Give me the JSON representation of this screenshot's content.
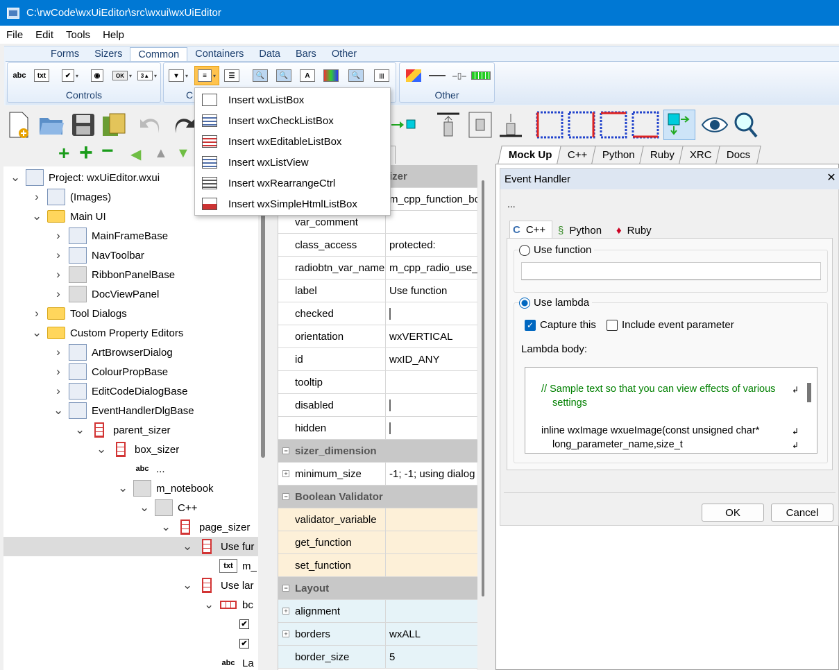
{
  "window": {
    "title": "C:\\rwCode\\wxUiEditor\\src\\wxui\\wxUiEditor"
  },
  "menu": [
    "File",
    "Edit",
    "Tools",
    "Help"
  ],
  "ribbon": {
    "tabs": [
      "Forms",
      "Sizers",
      "Common",
      "Containers",
      "Data",
      "Bars",
      "Other"
    ],
    "active_tab": "Common",
    "groups": {
      "controls": "Controls",
      "choices_partial": "C",
      "other": "Other"
    },
    "button_labels": {
      "abc": "abc",
      "txt": "txt",
      "ok": "OK"
    }
  },
  "popup_menu": [
    "Insert wxListBox",
    "Insert wxCheckListBox",
    "Insert wxEditableListBox",
    "Insert wxListView",
    "Insert wxRearrangeCtrl",
    "Insert wxSimpleHtmlListBox"
  ],
  "tree": [
    {
      "label": "Project: wxUiEditor.wxui",
      "depth": 0,
      "exp": "v",
      "icon": "project-icon"
    },
    {
      "label": "(Images)",
      "depth": 1,
      "exp": ">",
      "icon": "images-icon"
    },
    {
      "label": "Main UI",
      "depth": 1,
      "exp": "v",
      "icon": "folder-icon"
    },
    {
      "label": "MainFrameBase",
      "depth": 2,
      "exp": ">",
      "icon": "frame-icon"
    },
    {
      "label": "NavToolbar",
      "depth": 2,
      "exp": ">",
      "icon": "toolbar-icon"
    },
    {
      "label": "RibbonPanelBase",
      "depth": 2,
      "exp": ">",
      "icon": "panel-icon"
    },
    {
      "label": "DocViewPanel",
      "depth": 2,
      "exp": ">",
      "icon": "panel-icon"
    },
    {
      "label": "Tool Dialogs",
      "depth": 1,
      "exp": ">",
      "icon": "folder-icon"
    },
    {
      "label": "Custom Property Editors",
      "depth": 1,
      "exp": "v",
      "icon": "folder-icon"
    },
    {
      "label": "ArtBrowserDialog",
      "depth": 2,
      "exp": ">",
      "icon": "dialog-icon"
    },
    {
      "label": "ColourPropBase",
      "depth": 2,
      "exp": ">",
      "icon": "dialog-icon"
    },
    {
      "label": "EditCodeDialogBase",
      "depth": 2,
      "exp": ">",
      "icon": "dialog-icon"
    },
    {
      "label": "EventHandlerDlgBase",
      "depth": 2,
      "exp": "v",
      "icon": "dialog-icon"
    },
    {
      "label": "parent_sizer",
      "depth": 3,
      "exp": "v",
      "icon": "sizer-icon"
    },
    {
      "label": "box_sizer",
      "depth": 4,
      "exp": "v",
      "icon": "sizer-icon"
    },
    {
      "label": "...",
      "depth": 5,
      "exp": "",
      "icon": "static-text-icon"
    },
    {
      "label": "m_notebook",
      "depth": 5,
      "exp": "v",
      "icon": "notebook-icon"
    },
    {
      "label": "C++",
      "depth": 6,
      "exp": "v",
      "icon": "page-icon"
    },
    {
      "label": "page_sizer",
      "depth": 7,
      "exp": "v",
      "icon": "sizer-icon"
    },
    {
      "label": "Use fur",
      "depth": 8,
      "exp": "v",
      "icon": "static-box-sizer-icon",
      "selected": true
    },
    {
      "label": "m_",
      "depth": 9,
      "exp": "",
      "icon": "textctrl-icon"
    },
    {
      "label": "Use lar",
      "depth": 8,
      "exp": "v",
      "icon": "static-box-sizer-icon"
    },
    {
      "label": "bc",
      "depth": 9,
      "exp": "v",
      "icon": "hsizer-icon"
    },
    {
      "label": "",
      "depth": 10,
      "exp": "",
      "icon": "checkbox-icon"
    },
    {
      "label": "",
      "depth": 10,
      "exp": "",
      "icon": "checkbox-icon"
    },
    {
      "label": "La",
      "depth": 9,
      "exp": "",
      "icon": "static-text-icon"
    }
  ],
  "tree_icon_text": {
    "abc": "abc",
    "txt": "txt"
  },
  "properties": [
    {
      "type": "cat",
      "name": "izer"
    },
    {
      "name": "",
      "value": "m_cpp_function_bc"
    },
    {
      "name": "var_comment",
      "value": ""
    },
    {
      "name": "class_access",
      "value": "protected:"
    },
    {
      "name": "radiobtn_var_name",
      "value": "m_cpp_radio_use_fu"
    },
    {
      "name": "label",
      "value": "Use function"
    },
    {
      "name": "checked",
      "value": "",
      "box": true
    },
    {
      "name": "orientation",
      "value": "wxVERTICAL"
    },
    {
      "name": "id",
      "value": "wxID_ANY"
    },
    {
      "name": "tooltip",
      "value": ""
    },
    {
      "name": "disabled",
      "value": "",
      "box": true
    },
    {
      "name": "hidden",
      "value": "",
      "box": true
    },
    {
      "type": "cat",
      "name": "sizer_dimension"
    },
    {
      "name": "minimum_size",
      "value": "-1; -1; using dialog",
      "expand": true
    },
    {
      "type": "cat",
      "name": "Boolean Validator"
    },
    {
      "name": "validator_variable",
      "value": "",
      "tint": "yel"
    },
    {
      "name": "get_function",
      "value": "",
      "tint": "yel"
    },
    {
      "name": "set_function",
      "value": "",
      "tint": "yel"
    },
    {
      "type": "cat",
      "name": "Layout"
    },
    {
      "name": "alignment",
      "value": "",
      "tint": "blu",
      "expand": true
    },
    {
      "name": "borders",
      "value": "wxALL",
      "tint": "blu",
      "expand": true
    },
    {
      "name": "border_size",
      "value": "5",
      "tint": "blu"
    }
  ],
  "doc_tabs": [
    "Mock Up",
    "C++",
    "Python",
    "Ruby",
    "XRC",
    "Docs"
  ],
  "dialog": {
    "title": "Event Handler",
    "close": "✕",
    "event_text": "...",
    "lang_tabs": [
      "C++",
      "Python",
      "Ruby"
    ],
    "use_function": "Use function",
    "use_lambda": "Use lambda",
    "capture_this": "Capture this",
    "include_event_param": "Include event parameter",
    "lambda_body_label": "Lambda body:",
    "code": {
      "line1": "// Sample text so that you can view effects of various",
      "line1b": "settings",
      "line2": "inline wxImage wxueImage(const unsigned char*",
      "line2b": "long_parameter_name,size_t"
    },
    "ok": "OK",
    "cancel": "Cancel"
  },
  "colors": {
    "titlebar": "#0078d4",
    "accent": "#0067c0",
    "code_comment": "#008000"
  }
}
